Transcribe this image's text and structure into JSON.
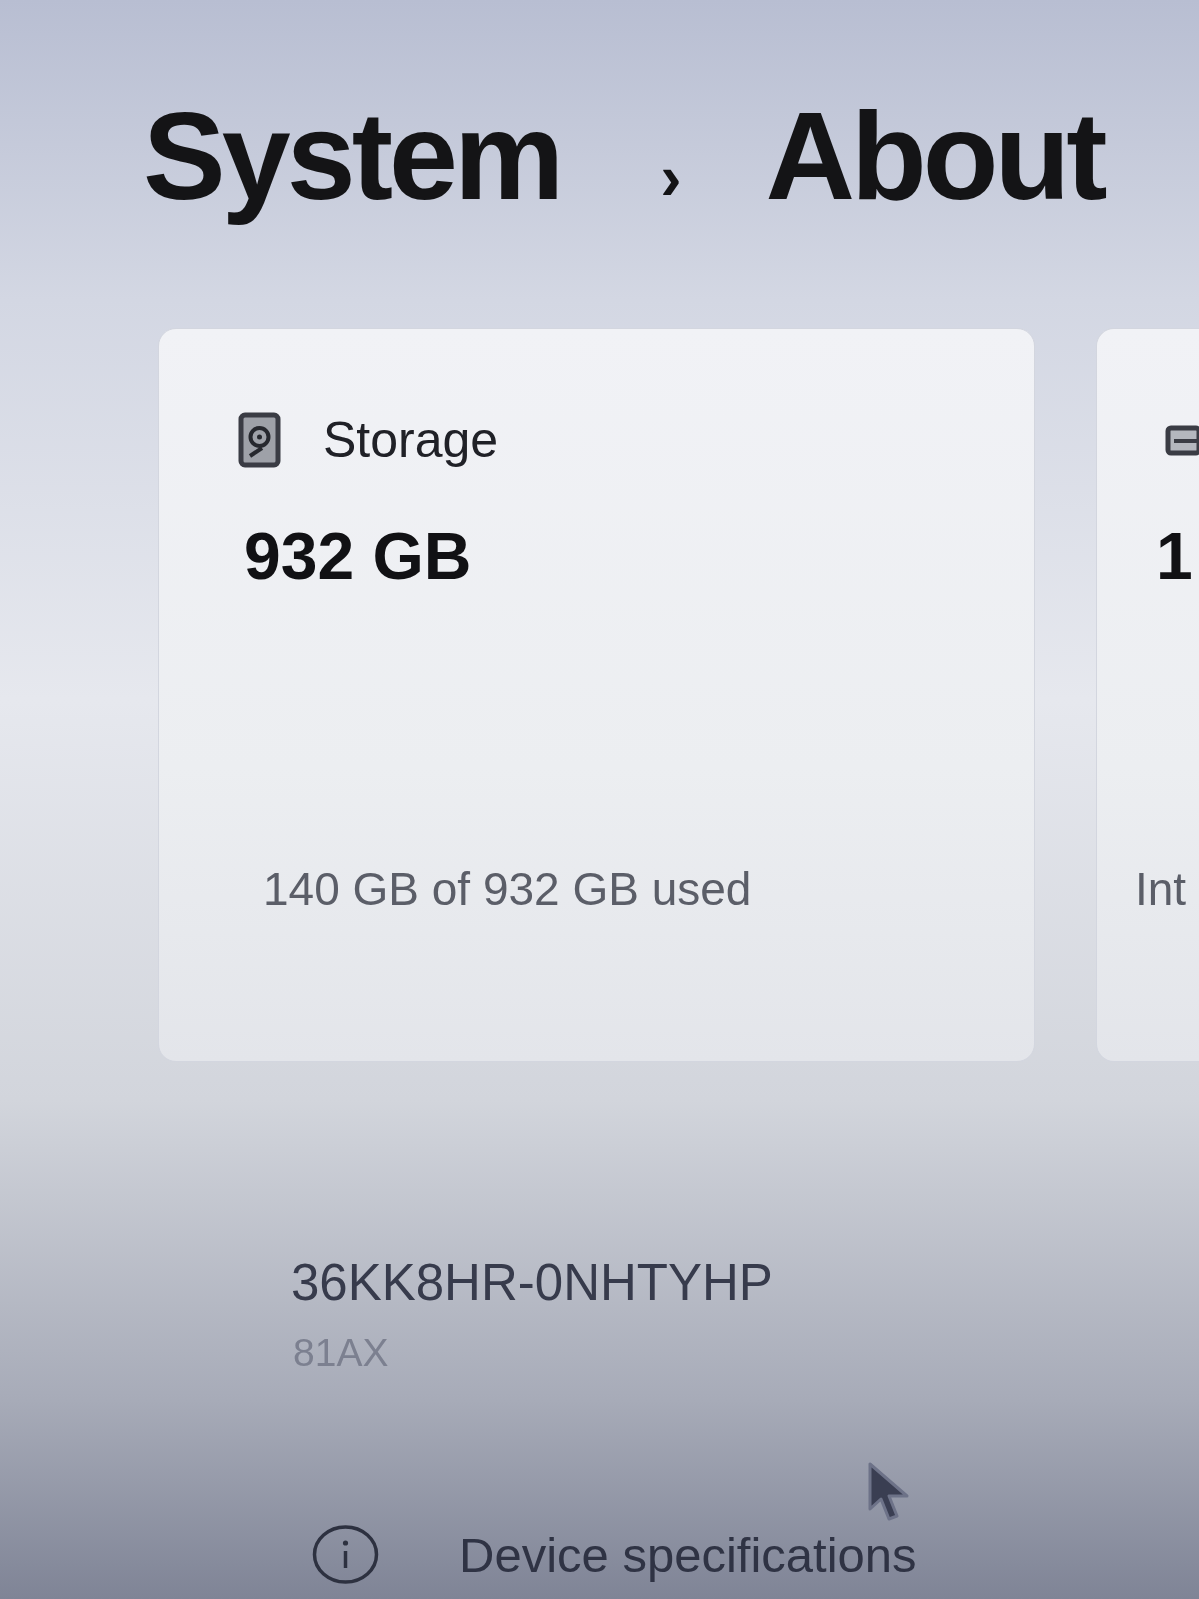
{
  "breadcrumb": {
    "parent": "System",
    "separator": "›",
    "current": "About"
  },
  "cards": [
    {
      "kind": "storage",
      "title": "Storage",
      "value": "932 GB",
      "detail": "140 GB of 932 GB used"
    },
    {
      "kind": "memory",
      "value": "1",
      "detail": "Int"
    }
  ],
  "device": {
    "identifier": "36KK8HR-0NHTYHP",
    "caption": "81AX"
  },
  "section": {
    "title": "Device specifications"
  }
}
